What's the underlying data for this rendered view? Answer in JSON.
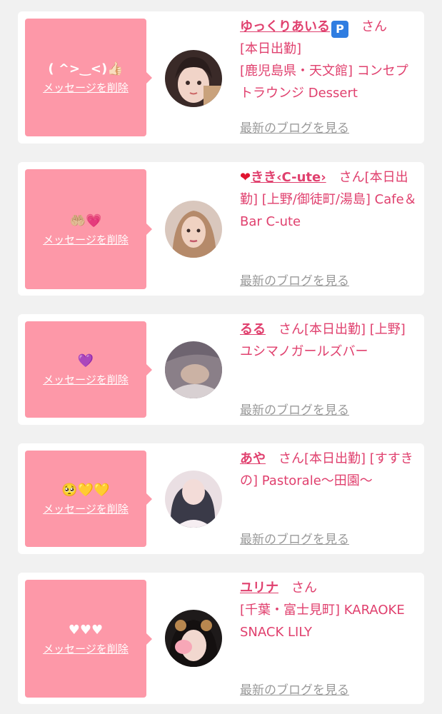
{
  "delete_label": "メッセージを削除",
  "san_label": "さん",
  "blog_label": "最新のブログを見る",
  "colors": {
    "bubble": "#fd98a8",
    "accent": "#e0406e",
    "muted": "#9a9a9a",
    "background": "#f1f1f1"
  },
  "cards": [
    {
      "message": "( ^>‿<)👍🏻",
      "name": "ゆっくりあいる",
      "name_badge_icon": "parking-badge-icon",
      "name_badge_text": "P",
      "info": "[本日出勤]\n[鹿児島県・天文館] コンセプトラウンジ Dessert"
    },
    {
      "message": "🤲🏼💗",
      "name_prefix_icon": "red-heart-icon",
      "name_prefix_text": "❤",
      "name": "きき‹C-ute›",
      "info": "[本日出勤]\n[上野/御徒町/湯島] Cafe＆Bar C-ute"
    },
    {
      "message": "💜",
      "name": "るる",
      "info": "[本日出勤]\n[上野] ユシマノガールズバー"
    },
    {
      "message": "🥺💛💛",
      "name": "あや",
      "info": "[本日出勤]\n[すすきの] Pastorale～田園～"
    },
    {
      "message": "♥♥♥",
      "name": "ユリナ",
      "info": "[千葉・富士見町] KARAOKE SNACK LILY"
    }
  ]
}
